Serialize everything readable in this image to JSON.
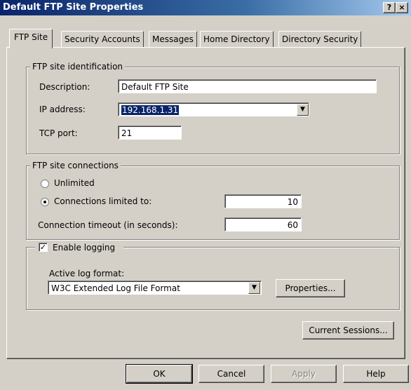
{
  "window": {
    "title": "Default FTP Site Properties",
    "help_glyph": "?",
    "close_glyph": "×"
  },
  "tabs": [
    "FTP Site",
    "Security Accounts",
    "Messages",
    "Home Directory",
    "Directory Security"
  ],
  "identification": {
    "legend": "FTP site identification",
    "description_label": "Description:",
    "description_value": "Default FTP Site",
    "ip_label": "IP address:",
    "ip_value": "192.168.1.31",
    "tcp_label": "TCP port:",
    "tcp_value": "21"
  },
  "connections": {
    "legend": "FTP site connections",
    "unlimited_label": "Unlimited",
    "unlimited_selected": false,
    "limited_label": "Connections limited to:",
    "limited_selected": true,
    "limited_value": "10",
    "timeout_label": "Connection timeout (in seconds):",
    "timeout_value": "60"
  },
  "logging": {
    "enable_label": "Enable logging",
    "enabled": true,
    "format_label": "Active log format:",
    "format_value": "W3C Extended Log File Format",
    "properties_label": "Properties..."
  },
  "current_sessions_label": "Current Sessions...",
  "buttons": {
    "ok": "OK",
    "cancel": "Cancel",
    "apply": "Apply",
    "help": "Help"
  },
  "icons": {
    "dropdown": "▼",
    "check": "✓"
  }
}
